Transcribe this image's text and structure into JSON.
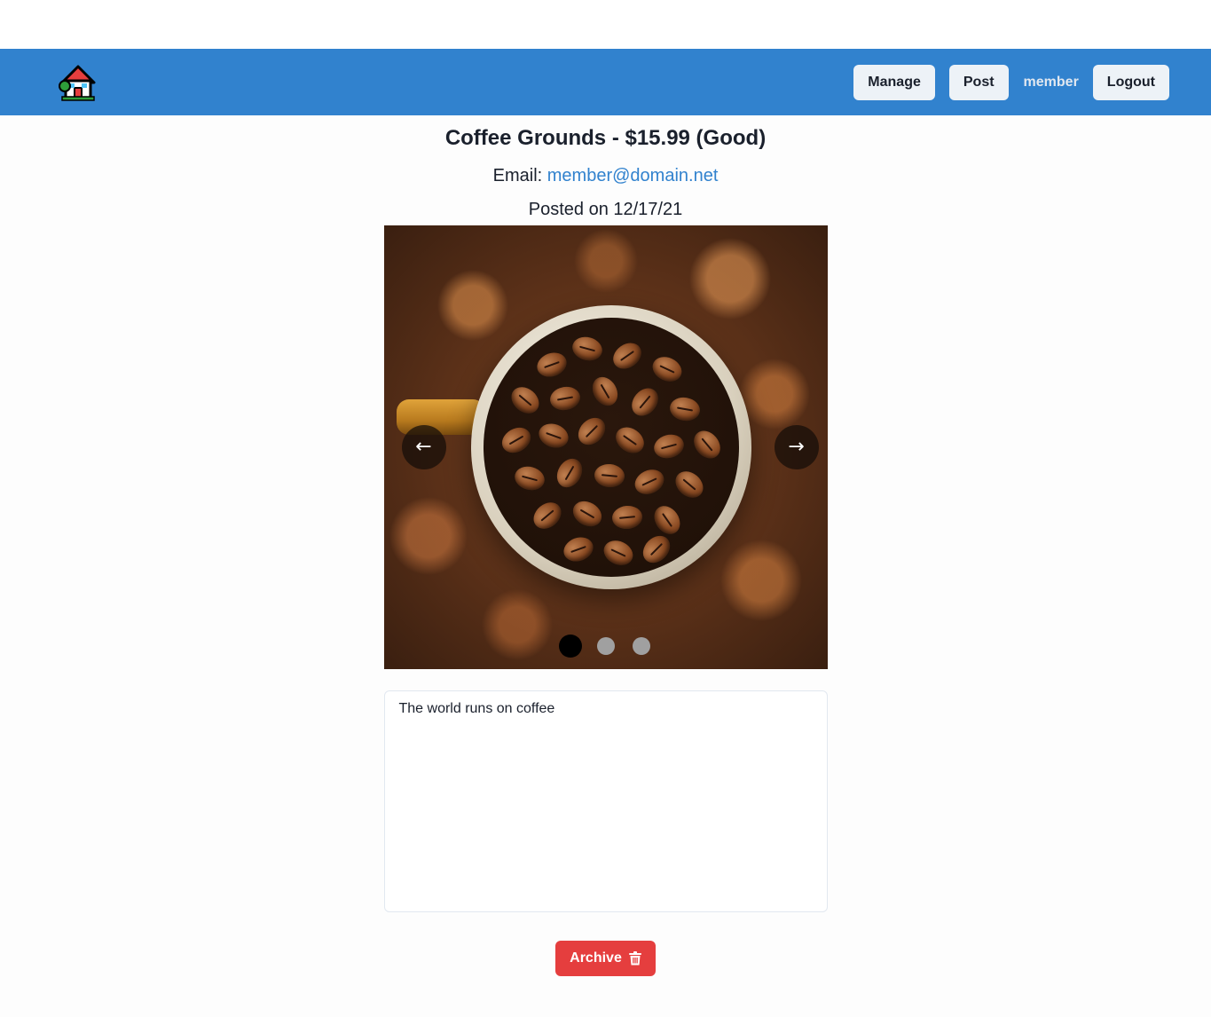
{
  "header": {
    "logo_icon": "house-icon",
    "manage_label": "Manage",
    "post_label": "Post",
    "username": "member",
    "logout_label": "Logout"
  },
  "listing": {
    "title": "Coffee Grounds - $15.99 (Good)",
    "email_label": "Email:",
    "email": "member@domain.net",
    "posted": "Posted on 12/17/21",
    "description": "The world runs on coffee"
  },
  "carousel": {
    "image_icon": "coffee-beans-image",
    "prev_label": "←",
    "next_label": "→",
    "slide_count": 3,
    "active_slide": 1
  },
  "actions": {
    "archive_label": "Archive",
    "archive_icon": "trash-icon",
    "archive_color": "#e53e3e"
  },
  "colors": {
    "navbar": "#3182ce",
    "link": "#3182ce"
  }
}
